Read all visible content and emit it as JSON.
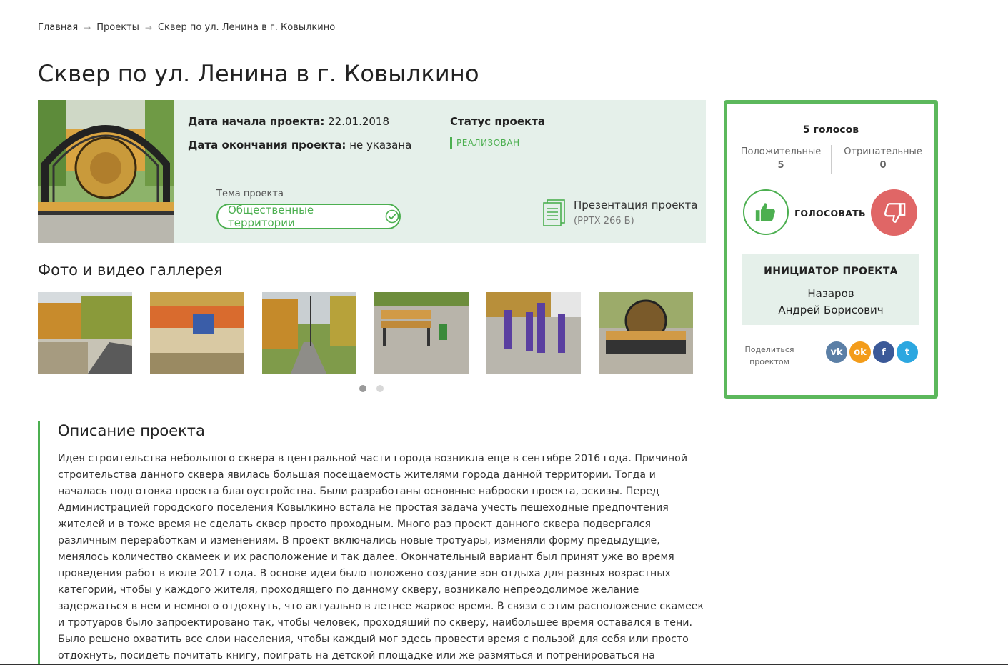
{
  "breadcrumb": {
    "home": "Главная",
    "projects": "Проекты",
    "current": "Сквер по ул. Ленина в г. Ковылкино",
    "separator": "→"
  },
  "title": "Сквер по ул. Ленина в г. Ковылкино",
  "project": {
    "start_label": "Дата начала проекта:",
    "start_value": "22.01.2018",
    "end_label": "Дата окончания проекта:",
    "end_value": "не указана",
    "status_label": "Статус проекта",
    "status_value": "РЕАЛИЗОВАН",
    "theme_label": "Тема проекта",
    "theme_value": "Общественные территории",
    "presentation_title": "Презентация проекта",
    "presentation_meta": "(PPTX 266 Б)"
  },
  "gallery": {
    "title": "Фото и видео галлерея",
    "items": 6,
    "pages": 2,
    "active_page": 1
  },
  "description": {
    "title": "Описание проекта",
    "text": "Идея строительства небольшого сквера в центральной части города возникла еще в сентябре 2016 года. Причиной строительства данного сквера явилась большая посещаемость жителями города данной территории. Тогда и началась подготовка проекта благоустройства. Были разработаны основные наброски проекта, эскизы. Перед Администрацией городского поселения Ковылкино встала не простая задача учесть пешеходные предпочтения жителей и в тоже время не сделать сквер просто проходным. Много раз проект данного сквера подвергался различным переработкам и изменениям. В проект включались новые тротуары, изменяли форму предыдущие, менялось количество скамеек и их расположение и так далее. Окончательный вариант был принят уже во время проведения работ в июле 2017 года. В основе идеи было положено создание зон отдыха для разных возрастных категорий, чтобы у каждого жителя, проходящего по данному скверу, возникало непреодолимое желание задержаться в нем и немного отдохнуть, что актуально в летнее жаркое время. В связи с этим расположение скамеек и тротуаров было запроектировано так, чтобы человек, проходящий по скверу, наибольшее время оставался в тени. Было решено охватить все слои населения, чтобы каждый мог здесь провести время с пользой для себя или просто отдохнуть, посидеть почитать книгу, поиграть на детской площадке или же размяться и потренироваться на спортивной площадке. Привлечена была к проектированию"
  },
  "votes": {
    "total": "5 голосов",
    "positive_label": "Положительные",
    "positive_count": "5",
    "negative_label": "Отрицательные",
    "negative_count": "0",
    "vote_label": "ГОЛОСОВАТЬ"
  },
  "initiator": {
    "title": "ИНИЦИАТОР ПРОЕКТА",
    "surname": "Назаров",
    "name": "Андрей Борисович"
  },
  "share": {
    "label_line1": "Поделиться",
    "label_line2": "проектом",
    "vk": "vk",
    "ok": "ok",
    "fb": "f",
    "tw": "t"
  },
  "colors": {
    "accent_green": "#4caf50",
    "panel_bg": "#e5f0ea",
    "dislike_red": "#e06666"
  },
  "icons": {
    "like": "thumbs-up-icon",
    "dislike": "thumbs-down-icon",
    "document": "document-icon",
    "check": "check-circle-icon",
    "separator": "arrow-right-icon"
  }
}
